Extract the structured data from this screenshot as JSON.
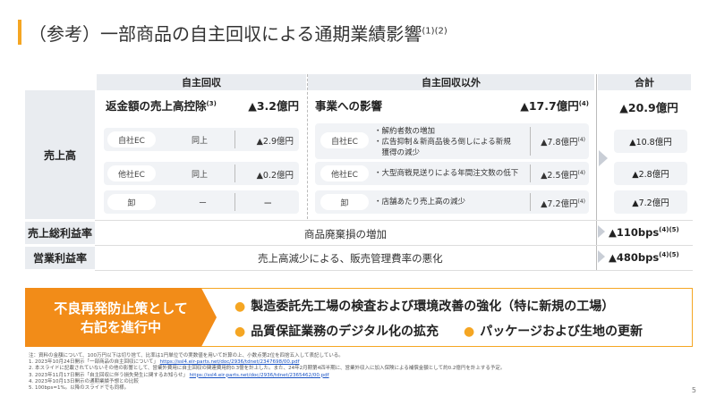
{
  "title": {
    "text": "（参考）一部商品の自主回収による通期業績影響",
    "sup": "(1)(2)"
  },
  "headers": {
    "recall": "自主回収",
    "other": "自主回収以外",
    "total": "合計"
  },
  "rows": {
    "sales": "売上高",
    "gross": "売上総利益率",
    "operating": "営業利益率"
  },
  "recall_section": {
    "title": "返金額の売上高控除",
    "title_sup": "(3)",
    "value": "▲3.2億円",
    "items": [
      {
        "channel": "自社EC",
        "text": "同上",
        "value": "▲2.9億円"
      },
      {
        "channel": "他社EC",
        "text": "同上",
        "value": "▲0.2億円"
      },
      {
        "channel": "卸",
        "text": "ー",
        "value": "ー"
      }
    ]
  },
  "other_section": {
    "title": "事業への影響",
    "value": "▲17.7億円",
    "value_sup": "(4)",
    "items": [
      {
        "channel": "自社EC",
        "bullets": [
          "・解約者数の増加",
          "・広告抑制＆新商品後ろ倒しによる新規",
          "　獲得の減少"
        ],
        "value": "▲7.8億円",
        "value_sup": "(4)"
      },
      {
        "channel": "他社EC",
        "bullets": [
          "・大型商戦見送りによる年間注文数の低下"
        ],
        "value": "▲2.5億円",
        "value_sup": "(4)"
      },
      {
        "channel": "卸",
        "bullets": [
          "・店舗あたり売上高の減少"
        ],
        "value": "▲7.2億円",
        "value_sup": "(4)"
      }
    ]
  },
  "total_section": {
    "value": "▲20.9億円",
    "items": [
      "▲10.8億円",
      "▲2.8億円",
      "▲7.2億円"
    ]
  },
  "gross_text": "商品廃棄損の増加",
  "gross_value": "▲110bps",
  "gross_sup": "(4)(5)",
  "operating_text": "売上高減少による、販売管理費率の悪化",
  "operating_value": "▲480bps",
  "operating_sup": "(4)(5)",
  "prevention": {
    "label_line1": "不良再発防止策として",
    "label_line2": "右記を進行中",
    "measures": [
      "製造委託先工場の検査および環境改善の強化（特に新規の工場）",
      "品質保証業務のデジタル化の拡充",
      "パッケージおよび生地の更新"
    ]
  },
  "notes": [
    "注：資料の金額について、100万円以下は切り捨て、比率は1円単位での実数値を用いて計算の上、小数点第2位を四捨五入して表記している。",
    "1. 2023年10月24日開示「一部商品の自主回収について」",
    "2. 本スライドに記載されていないその他の影響として、営業外費用に自主回収の関連費用約0.3億を計上した。また、24年2月期第4四半期に、営業外収入に加入保険による補償金額として約0.2億円を計上する予定。",
    "3. 2023年11月17日開示「自主回収に伴う損失発生に関するお知らせ」",
    "4. 2023年10月13日開示の通期業績予想との比較",
    "5. 100bps=1%。以降のスライドでも同様。"
  ],
  "note_links": [
    "https://ssl4.eir-parts.net/doc/2936/tdnet/2347698/00.pdf",
    "https://ssl4.eir-parts.net/doc/2936/tdnet/2365462/00.pdf"
  ],
  "page_number": "5",
  "colors": {
    "accent": "#f5a623",
    "chevron": "#f28c18",
    "header_bg": "#e9ecf0"
  }
}
